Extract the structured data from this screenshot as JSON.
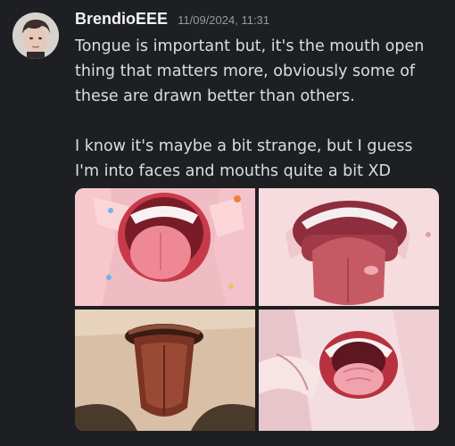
{
  "message": {
    "author": "BrendioEEE",
    "timestamp": "11/09/2024, 11:31",
    "paragraphs": [
      "Tongue is important but, it's the mouth open thing that matters more, obviously some of these are drawn better than others.",
      "I know it's maybe a bit strange, but I guess I'm into faces and mouths quite a bit XD"
    ]
  },
  "colors": {
    "background": "#1e1f22",
    "username": "#f2f3f5",
    "timestamp": "#949ba4",
    "text": "#dbdee1"
  },
  "attachments": {
    "count": 4
  }
}
